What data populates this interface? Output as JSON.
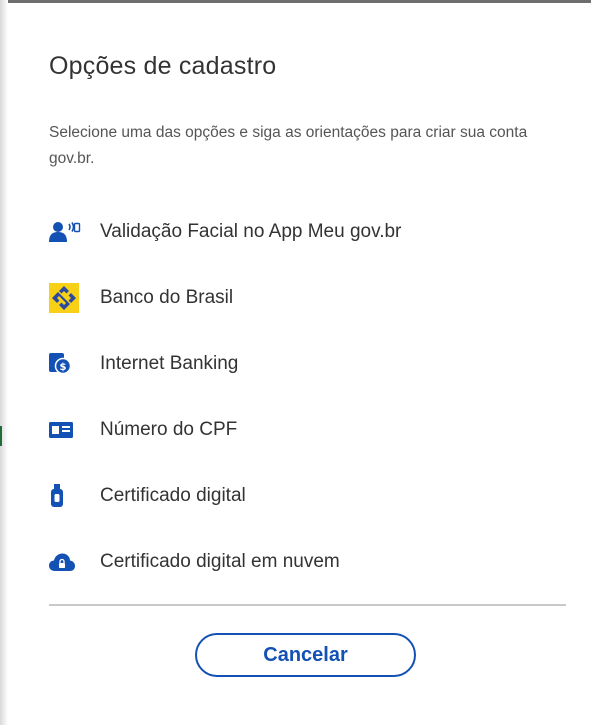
{
  "dialog": {
    "title": "Opções de cadastro",
    "subtitle": "Selecione uma das opções e siga as orientações para criar sua conta gov.br.",
    "options": [
      {
        "label": "Validação Facial no App Meu gov.br",
        "icon": "facial-recognition-icon"
      },
      {
        "label": "Banco do Brasil",
        "icon": "banco-do-brasil-logo-icon"
      },
      {
        "label": "Internet Banking",
        "icon": "internet-banking-icon"
      },
      {
        "label": "Número do CPF",
        "icon": "id-card-icon"
      },
      {
        "label": "Certificado digital",
        "icon": "usb-token-icon"
      },
      {
        "label": "Certificado digital em nuvem",
        "icon": "cloud-lock-icon"
      }
    ],
    "cancel_label": "Cancelar"
  },
  "colors": {
    "primary_blue": "#1351b4",
    "text": "#333333",
    "bb_yellow": "#f8d117",
    "bb_blue": "#2a4aa0"
  }
}
